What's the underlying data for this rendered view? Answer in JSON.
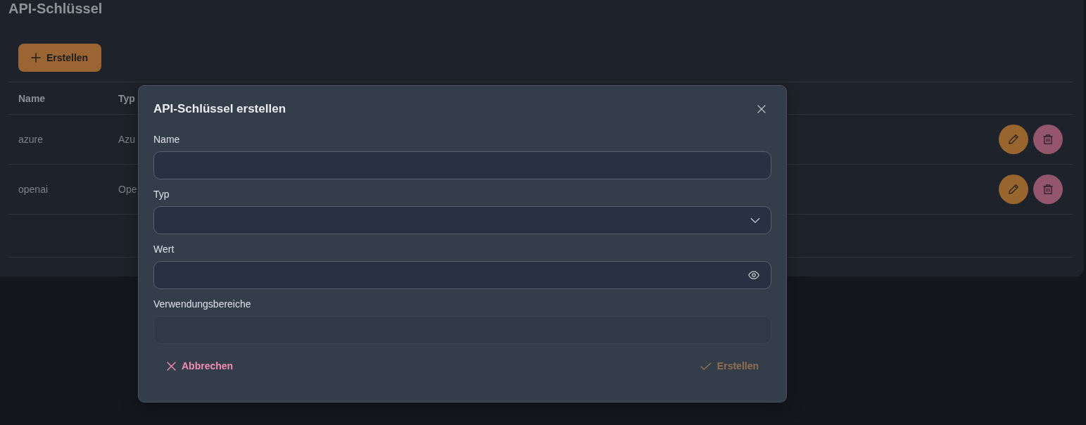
{
  "page": {
    "title": "API-Schlüssel",
    "create_button": {
      "label": "Erstellen"
    }
  },
  "table": {
    "columns": [
      "Name",
      "Typ"
    ],
    "rows": [
      {
        "name": "azure",
        "type": "Azu"
      },
      {
        "name": "openai",
        "type": "Ope"
      }
    ]
  },
  "dialog": {
    "title": "API-Schlüssel erstellen",
    "fields": [
      {
        "kind": "text",
        "label": "Name",
        "disabled": false
      },
      {
        "kind": "select",
        "label": "Typ",
        "disabled": false
      },
      {
        "kind": "password",
        "label": "Wert",
        "disabled": false
      },
      {
        "kind": "multiselect",
        "label": "Verwendungsbereiche",
        "disabled": true
      }
    ],
    "buttons": [
      {
        "kind": "cancel",
        "label": "Abbrechen",
        "disabled": false
      },
      {
        "kind": "submit",
        "label": "Erstellen",
        "disabled": true
      }
    ]
  }
}
